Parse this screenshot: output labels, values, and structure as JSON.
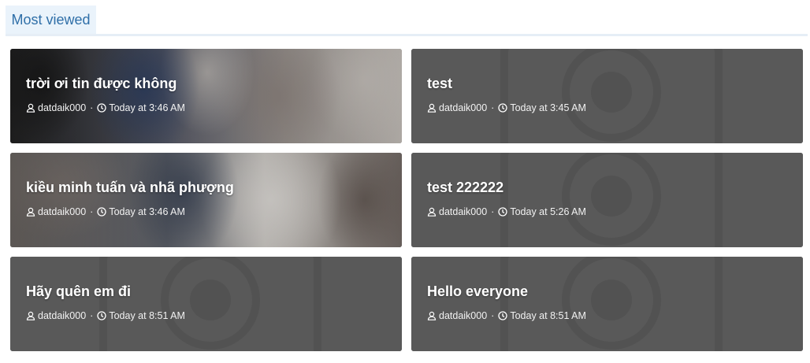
{
  "tab": {
    "label": "Most viewed"
  },
  "cards": [
    {
      "title": "trời ơi tin được không",
      "author": "datdaik000",
      "time": "Today at 3:46 AM",
      "thumb": "photo"
    },
    {
      "title": "test",
      "author": "datdaik000",
      "time": "Today at 3:45 AM",
      "thumb": "placeholder"
    },
    {
      "title": "kiều minh tuấn và nhã phượng",
      "author": "datdaik000",
      "time": "Today at 3:46 AM",
      "thumb": "photo"
    },
    {
      "title": "test 222222",
      "author": "datdaik000",
      "time": "Today at 5:26 AM",
      "thumb": "placeholder"
    },
    {
      "title": "Hãy quên em đi",
      "author": "datdaik000",
      "time": "Today at 8:51 AM",
      "thumb": "placeholder"
    },
    {
      "title": "Hello everyone",
      "author": "datdaik000",
      "time": "Today at 8:51 AM",
      "thumb": "placeholder"
    }
  ],
  "meta_separator": "·",
  "icons": {
    "author": "user-icon",
    "time": "clock-icon",
    "placeholder": "camera-icon"
  }
}
